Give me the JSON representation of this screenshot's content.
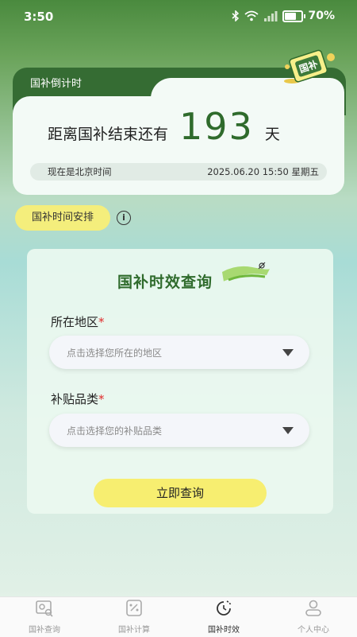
{
  "status_bar": {
    "time": "3:50",
    "battery": "70%"
  },
  "countdown": {
    "tab_label": "国补倒计时",
    "prefix": "距离国补结束还有",
    "days": "193",
    "suffix": "天",
    "time_label": "现在是北京时间",
    "datetime": "2025.06.20   15:50 星期五",
    "badge_text": "国补"
  },
  "schedule": {
    "label": "国补时间安排",
    "info_symbol": "i"
  },
  "query": {
    "title": "国补时效查询",
    "region_label": "所在地区",
    "region_placeholder": "点击选择您所在的地区",
    "category_label": "补贴品类",
    "category_placeholder": "点击选择您的补贴品类",
    "required_mark": "*",
    "submit_label": "立即查询"
  },
  "tabs": [
    {
      "label": "国补查询"
    },
    {
      "label": "国补计算"
    },
    {
      "label": "国补时效"
    },
    {
      "label": "个人中心"
    }
  ],
  "colors": {
    "brand_green": "#356c33",
    "accent_yellow": "#f4ee7c",
    "required_red": "#e02a2a"
  }
}
